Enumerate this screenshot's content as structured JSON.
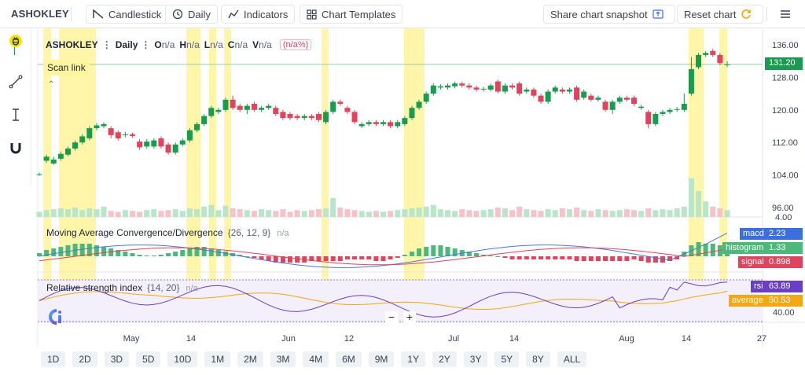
{
  "topbar": {
    "ticker": "ASHOKLEY",
    "candlestick": "Candlestick",
    "interval": "Daily",
    "indicators": "Indicators",
    "templates": "Chart Templates",
    "snapshot": "Share chart snapshot",
    "reset": "Reset chart"
  },
  "legend": {
    "symbol": "ASHOKLEY",
    "interval": "Daily",
    "o_label": "O",
    "o_val": "n/a",
    "h_label": "H",
    "h_val": "n/a",
    "l_label": "L",
    "l_val": "n/a",
    "c_label": "C",
    "c_val": "n/a",
    "v_label": "V",
    "v_val": "n/a",
    "pct": "(n/a%)",
    "scan_link": "Scan link"
  },
  "macd": {
    "title": "Moving Average Convergence/Divergence",
    "params": "{26, 12, 9}",
    "na": "n/a",
    "macd_label": "macd",
    "macd_val": "2.23",
    "hist_label": "histogram",
    "hist_val": "1.33",
    "signal_label": "signal",
    "signal_val": "0.898"
  },
  "rsi": {
    "title": "Relative strength index",
    "params": "{14, 20}",
    "na": "n/a",
    "rsi_label": "rsi",
    "rsi_val": "63.89",
    "avg_label": "average",
    "avg_val": "50.53",
    "axis_label": "40.00"
  },
  "zoom": {
    "minus": "−",
    "plus": "+"
  },
  "last_price": "131.20",
  "colors": {
    "up": "#1a9c4f",
    "down": "#e0435b",
    "highlight": "#fff59a",
    "macd_line": "#4a78e0",
    "signal_line": "#e0435b",
    "rsi_line": "#6a3fc7",
    "avg_line": "#f3a712"
  },
  "ranges": [
    "1D",
    "2D",
    "3D",
    "5D",
    "10D",
    "1M",
    "2M",
    "3M",
    "4M",
    "6M",
    "9M",
    "1Y",
    "2Y",
    "3Y",
    "5Y",
    "8Y",
    "ALL"
  ],
  "chart_data": {
    "type": "candlestick",
    "y_ticks": [
      "136.00",
      "128.00",
      "120.00",
      "112.00",
      "104.00",
      "96.00",
      "4.00"
    ],
    "ylim": [
      94,
      138
    ],
    "x_ticks": [
      "May",
      "14",
      "Jun",
      "12",
      "Jul",
      "14",
      "Aug",
      "14",
      "27"
    ],
    "candles": [
      {
        "o": 104.0,
        "c": 104.2,
        "h": 104.6,
        "l": 103.8
      },
      {
        "o": 107.5,
        "c": 108.5,
        "h": 109.0,
        "l": 107.0
      },
      {
        "o": 106.8,
        "c": 107.8,
        "h": 108.5,
        "l": 106.5
      },
      {
        "o": 108.0,
        "c": 109.2,
        "h": 109.8,
        "l": 107.5
      },
      {
        "o": 109.0,
        "c": 110.5,
        "h": 111.0,
        "l": 108.6
      },
      {
        "o": 110.5,
        "c": 112.0,
        "h": 112.5,
        "l": 110.0
      },
      {
        "o": 112.0,
        "c": 113.5,
        "h": 114.0,
        "l": 111.5
      },
      {
        "o": 113.0,
        "c": 115.5,
        "h": 116.0,
        "l": 112.5
      },
      {
        "o": 115.5,
        "c": 116.2,
        "h": 116.8,
        "l": 115.0
      },
      {
        "o": 116.0,
        "c": 116.5,
        "h": 117.0,
        "l": 115.5
      },
      {
        "o": 115.5,
        "c": 113.8,
        "h": 116.0,
        "l": 113.0
      },
      {
        "o": 114.5,
        "c": 113.0,
        "h": 115.0,
        "l": 112.5
      },
      {
        "o": 113.8,
        "c": 114.0,
        "h": 114.6,
        "l": 113.3
      },
      {
        "o": 114.0,
        "c": 113.6,
        "h": 114.4,
        "l": 113.2
      },
      {
        "o": 112.2,
        "c": 110.8,
        "h": 112.8,
        "l": 110.2
      },
      {
        "o": 111.0,
        "c": 112.2,
        "h": 112.8,
        "l": 110.5
      },
      {
        "o": 111.0,
        "c": 112.5,
        "h": 113.0,
        "l": 110.5
      },
      {
        "o": 113.0,
        "c": 111.0,
        "h": 113.5,
        "l": 110.5
      },
      {
        "o": 111.5,
        "c": 109.5,
        "h": 112.0,
        "l": 109.0
      },
      {
        "o": 109.5,
        "c": 111.5,
        "h": 112.0,
        "l": 109.0
      },
      {
        "o": 111.5,
        "c": 112.5,
        "h": 113.0,
        "l": 111.0
      },
      {
        "o": 112.5,
        "c": 115.0,
        "h": 115.5,
        "l": 112.0
      },
      {
        "o": 115.0,
        "c": 116.5,
        "h": 117.0,
        "l": 114.5
      },
      {
        "o": 116.5,
        "c": 118.5,
        "h": 119.0,
        "l": 116.0
      },
      {
        "o": 118.5,
        "c": 120.5,
        "h": 121.0,
        "l": 118.0
      },
      {
        "o": 119.5,
        "c": 120.0,
        "h": 120.5,
        "l": 119.0
      },
      {
        "o": 120.0,
        "c": 122.5,
        "h": 123.0,
        "l": 119.5
      },
      {
        "o": 122.5,
        "c": 120.5,
        "h": 123.5,
        "l": 120.0
      },
      {
        "o": 121.0,
        "c": 120.0,
        "h": 121.5,
        "l": 119.5
      },
      {
        "o": 120.0,
        "c": 121.0,
        "h": 121.5,
        "l": 119.0
      },
      {
        "o": 121.5,
        "c": 120.0,
        "h": 122.0,
        "l": 119.5
      },
      {
        "o": 120.0,
        "c": 120.5,
        "h": 121.0,
        "l": 119.5
      },
      {
        "o": 120.5,
        "c": 121.0,
        "h": 121.5,
        "l": 120.0
      },
      {
        "o": 120.5,
        "c": 119.0,
        "h": 121.0,
        "l": 118.5
      },
      {
        "o": 119.5,
        "c": 118.0,
        "h": 120.0,
        "l": 117.5
      },
      {
        "o": 119.0,
        "c": 118.0,
        "h": 119.5,
        "l": 117.5
      },
      {
        "o": 118.5,
        "c": 118.0,
        "h": 119.0,
        "l": 117.5
      },
      {
        "o": 118.0,
        "c": 118.5,
        "h": 119.0,
        "l": 117.5
      },
      {
        "o": 118.5,
        "c": 118.0,
        "h": 119.0,
        "l": 117.5
      },
      {
        "o": 119.0,
        "c": 117.5,
        "h": 119.5,
        "l": 117.0
      },
      {
        "o": 117.0,
        "c": 119.5,
        "h": 120.0,
        "l": 116.5
      },
      {
        "o": 119.5,
        "c": 122.0,
        "h": 122.5,
        "l": 119.0
      },
      {
        "o": 122.0,
        "c": 121.5,
        "h": 122.5,
        "l": 121.0
      },
      {
        "o": 120.5,
        "c": 119.5,
        "h": 121.0,
        "l": 119.0
      },
      {
        "o": 119.5,
        "c": 117.0,
        "h": 120.0,
        "l": 116.5
      },
      {
        "o": 116.0,
        "c": 116.5,
        "h": 117.0,
        "l": 115.5
      },
      {
        "o": 116.5,
        "c": 117.0,
        "h": 117.5,
        "l": 116.0
      },
      {
        "o": 117.0,
        "c": 116.5,
        "h": 117.5,
        "l": 116.0
      },
      {
        "o": 116.5,
        "c": 117.0,
        "h": 117.5,
        "l": 116.0
      },
      {
        "o": 117.0,
        "c": 116.0,
        "h": 117.5,
        "l": 115.5
      },
      {
        "o": 116.0,
        "c": 117.0,
        "h": 117.5,
        "l": 115.5
      },
      {
        "o": 116.5,
        "c": 118.0,
        "h": 118.5,
        "l": 116.0
      },
      {
        "o": 118.0,
        "c": 120.5,
        "h": 121.0,
        "l": 117.5
      },
      {
        "o": 120.5,
        "c": 122.0,
        "h": 122.5,
        "l": 120.0
      },
      {
        "o": 122.0,
        "c": 124.0,
        "h": 124.5,
        "l": 121.5
      },
      {
        "o": 124.0,
        "c": 126.0,
        "h": 126.5,
        "l": 123.5
      },
      {
        "o": 125.5,
        "c": 125.8,
        "h": 126.3,
        "l": 125.0
      },
      {
        "o": 125.5,
        "c": 126.0,
        "h": 126.5,
        "l": 125.0
      },
      {
        "o": 125.8,
        "c": 126.5,
        "h": 127.0,
        "l": 125.3
      },
      {
        "o": 126.5,
        "c": 126.0,
        "h": 127.0,
        "l": 125.5
      },
      {
        "o": 126.0,
        "c": 125.5,
        "h": 126.5,
        "l": 125.0
      },
      {
        "o": 125.5,
        "c": 125.0,
        "h": 126.0,
        "l": 124.5
      },
      {
        "o": 125.0,
        "c": 125.2,
        "h": 125.7,
        "l": 124.5
      },
      {
        "o": 125.0,
        "c": 126.0,
        "h": 126.5,
        "l": 124.5
      },
      {
        "o": 127.0,
        "c": 124.5,
        "h": 127.5,
        "l": 124.0
      },
      {
        "o": 124.5,
        "c": 126.0,
        "h": 126.5,
        "l": 124.0
      },
      {
        "o": 126.0,
        "c": 125.5,
        "h": 126.5,
        "l": 125.0
      },
      {
        "o": 126.5,
        "c": 124.0,
        "h": 127.0,
        "l": 123.5
      },
      {
        "o": 124.5,
        "c": 125.0,
        "h": 125.5,
        "l": 124.0
      },
      {
        "o": 125.0,
        "c": 123.5,
        "h": 125.5,
        "l": 123.0
      },
      {
        "o": 123.5,
        "c": 122.0,
        "h": 124.0,
        "l": 121.5
      },
      {
        "o": 122.0,
        "c": 124.5,
        "h": 125.0,
        "l": 121.5
      },
      {
        "o": 124.5,
        "c": 125.5,
        "h": 126.0,
        "l": 124.0
      },
      {
        "o": 125.0,
        "c": 124.5,
        "h": 125.5,
        "l": 124.0
      },
      {
        "o": 124.5,
        "c": 125.0,
        "h": 125.5,
        "l": 124.0
      },
      {
        "o": 125.5,
        "c": 122.5,
        "h": 126.0,
        "l": 122.0
      },
      {
        "o": 123.0,
        "c": 124.5,
        "h": 125.0,
        "l": 122.5
      },
      {
        "o": 123.5,
        "c": 122.5,
        "h": 124.0,
        "l": 122.0
      },
      {
        "o": 122.5,
        "c": 123.0,
        "h": 123.5,
        "l": 122.0
      },
      {
        "o": 122.0,
        "c": 120.0,
        "h": 122.5,
        "l": 119.5
      },
      {
        "o": 120.0,
        "c": 122.0,
        "h": 122.5,
        "l": 119.0
      },
      {
        "o": 122.0,
        "c": 123.0,
        "h": 123.5,
        "l": 121.5
      },
      {
        "o": 123.0,
        "c": 122.5,
        "h": 123.5,
        "l": 122.0
      },
      {
        "o": 123.0,
        "c": 121.5,
        "h": 123.5,
        "l": 121.0
      },
      {
        "o": 120.5,
        "c": 120.8,
        "h": 121.3,
        "l": 120.0
      },
      {
        "o": 119.5,
        "c": 116.5,
        "h": 120.0,
        "l": 115.5
      },
      {
        "o": 116.5,
        "c": 119.0,
        "h": 119.5,
        "l": 116.0
      },
      {
        "o": 119.0,
        "c": 119.5,
        "h": 120.0,
        "l": 118.5
      },
      {
        "o": 119.5,
        "c": 120.0,
        "h": 120.5,
        "l": 119.0
      },
      {
        "o": 120.0,
        "c": 120.2,
        "h": 120.7,
        "l": 119.5
      },
      {
        "o": 120.0,
        "c": 121.5,
        "h": 124.0,
        "l": 119.5
      },
      {
        "o": 124.0,
        "c": 130.0,
        "h": 133.0,
        "l": 123.5
      },
      {
        "o": 130.5,
        "c": 133.5,
        "h": 134.0,
        "l": 130.0
      },
      {
        "o": 133.5,
        "c": 134.0,
        "h": 134.5,
        "l": 133.0
      },
      {
        "o": 134.5,
        "c": 133.5,
        "h": 135.0,
        "l": 133.0
      },
      {
        "o": 133.5,
        "c": 131.5,
        "h": 134.0,
        "l": 131.0
      },
      {
        "o": 131.2,
        "c": 131.2,
        "h": 132.0,
        "l": 130.5
      }
    ]
  }
}
